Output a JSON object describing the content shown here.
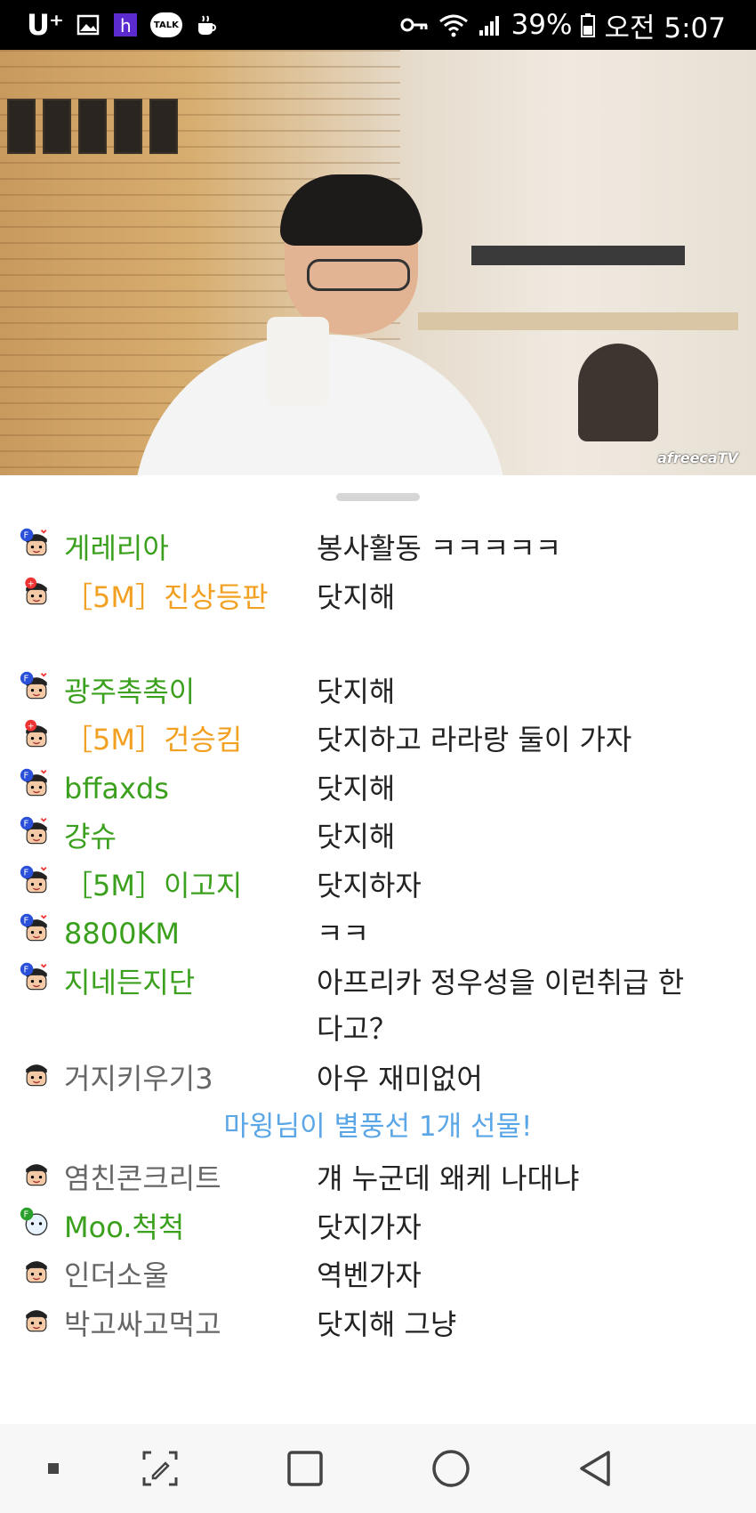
{
  "status_bar": {
    "carrier": "U⁺",
    "battery": "39%",
    "time": "오전 5:07",
    "icons": [
      "gallery-icon",
      "h-app-icon",
      "kakaotalk-icon",
      "cup-icon",
      "key-icon",
      "wifi-icon",
      "signal-icon",
      "battery-icon"
    ],
    "talk_label": "TALK"
  },
  "video": {
    "watermark": "afreecaTV"
  },
  "chat": {
    "messages": [
      {
        "nick": "게레리아",
        "text": "봉사활동 ㅋㅋㅋㅋㅋ",
        "color": "#3aa01d",
        "badge": "fan"
      },
      {
        "nick": "［5M］진상등판",
        "text": "닷지해",
        "color": "#f2a021",
        "badge": "top"
      },
      {
        "nick": "광주촉촉이",
        "text": "닷지해",
        "color": "#3aa01d",
        "badge": "fan"
      },
      {
        "nick": "［5M］건승킴",
        "text": "닷지하고 라라랑 둘이 가자",
        "color": "#f2a021",
        "badge": "top"
      },
      {
        "nick": "bffaxds",
        "text": "닷지해",
        "color": "#3aa01d",
        "badge": "fan"
      },
      {
        "nick": "걍슈",
        "text": "닷지해",
        "color": "#3aa01d",
        "badge": "fan"
      },
      {
        "nick": "［5M］이고지",
        "text": "닷지하자",
        "color": "#3aa01d",
        "badge": "fan"
      },
      {
        "nick": "8800KM",
        "text": "ㅋㅋ",
        "color": "#3aa01d",
        "badge": "fan"
      },
      {
        "nick": "지네든지단",
        "text": "아프리카 정우성을 이런취급 한다고？",
        "color": "#3aa01d",
        "badge": "fan"
      },
      {
        "nick": "거지키우기3",
        "text": "아우 재미없어",
        "color": "#666666",
        "badge": "none"
      }
    ],
    "notice": "마윙님이 별풍선 1개 선물!",
    "messages2": [
      {
        "nick": "염친콘크리트",
        "text": "걔 누군데 왜케 나대냐",
        "color": "#666666",
        "badge": "none"
      },
      {
        "nick": "Moo.척척",
        "text": "닷지가자",
        "color": "#3aa01d",
        "badge": "bear"
      },
      {
        "nick": "인더소울",
        "text": "역벤가자",
        "color": "#666666",
        "badge": "none"
      },
      {
        "nick": "박고싸고먹고",
        "text": "닷지해 그냥",
        "color": "#666666",
        "badge": "none"
      }
    ]
  },
  "nav": {
    "buttons": [
      "recent-dot-icon",
      "screenshot-edit-icon",
      "recents-square-icon",
      "home-circle-icon",
      "back-triangle-icon"
    ]
  }
}
